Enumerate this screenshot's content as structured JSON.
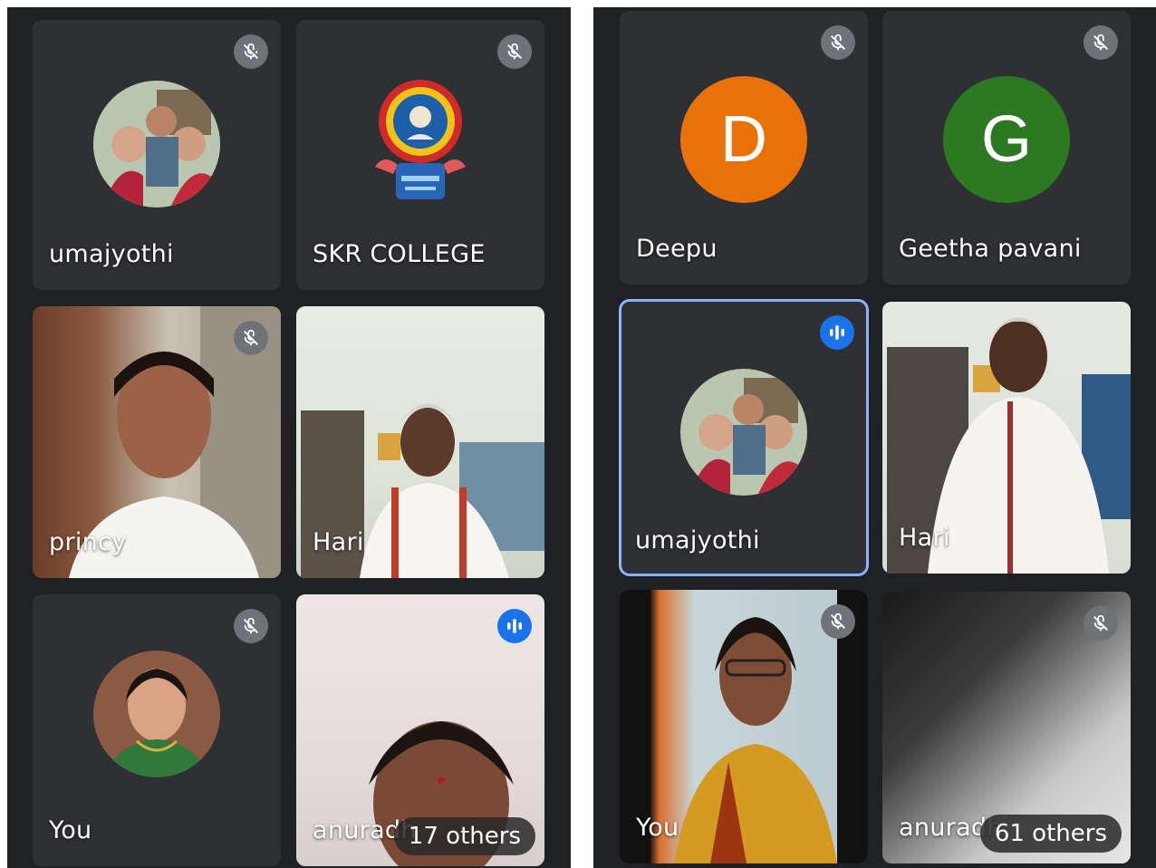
{
  "left": {
    "tiles": [
      {
        "name": "umajyothi",
        "state": "muted"
      },
      {
        "name": "SKR COLLEGE",
        "state": "muted"
      },
      {
        "name": "princy",
        "state": "muted"
      },
      {
        "name": "Hari",
        "state": "none"
      },
      {
        "name": "You",
        "state": "muted"
      },
      {
        "name": "anuradh",
        "state": "speaking",
        "others": "17 others"
      }
    ]
  },
  "right": {
    "tiles": [
      {
        "name": "Deepu",
        "state": "muted",
        "initial": "D",
        "color": "#e8710a"
      },
      {
        "name": "Geetha pavani",
        "state": "muted",
        "initial": "G",
        "color": "#2b7a22"
      },
      {
        "name": "umajyothi",
        "state": "speaking"
      },
      {
        "name": "Hari",
        "state": "none"
      },
      {
        "name": "You",
        "state": "muted"
      },
      {
        "name": "anuradh",
        "state": "muted",
        "others": "61 others"
      }
    ]
  },
  "colors": {
    "background": "#202124",
    "tile": "#2f3033",
    "speaking": "#1a73e8",
    "active_border": "#8ab4f8",
    "mute_badge": "#6f7277"
  },
  "icons": {
    "muted": "mic-off-icon",
    "speaking": "audio-bars-icon"
  }
}
